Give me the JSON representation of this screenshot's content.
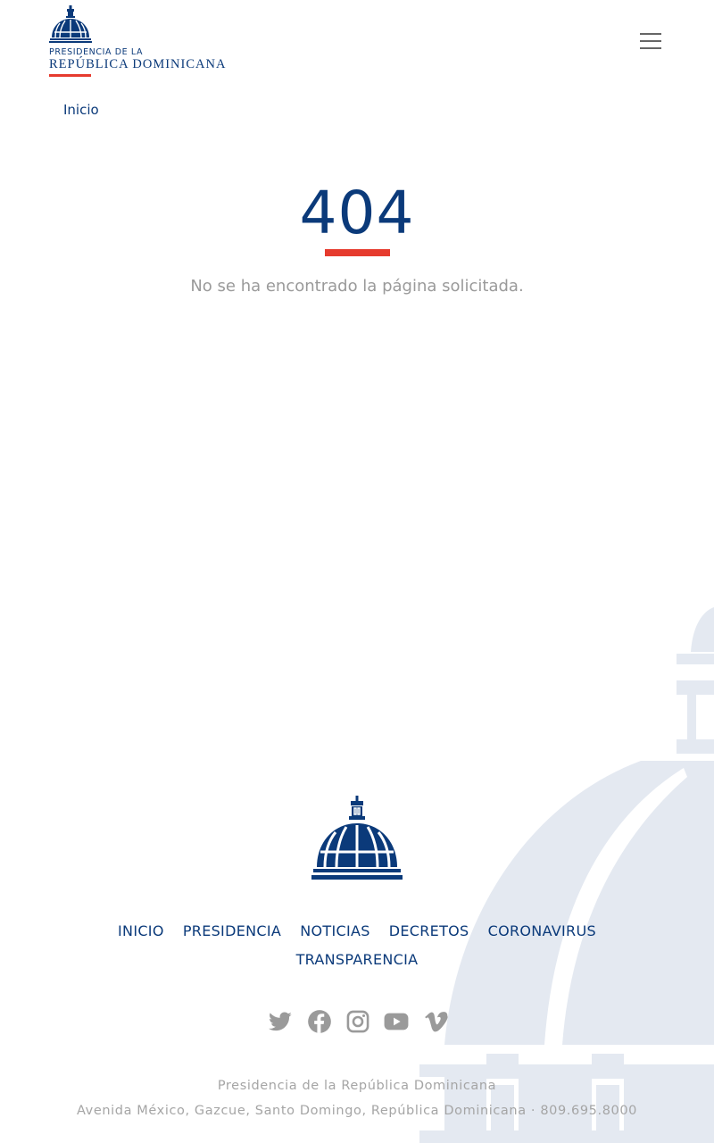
{
  "header": {
    "logo": {
      "line1": "PRESIDENCIA DE LA",
      "line2": "REPÚBLICA DOMINICANA"
    },
    "menu_icon": "hamburger-menu-icon"
  },
  "breadcrumb": {
    "home": "Inicio"
  },
  "error": {
    "code": "404",
    "message": "No se ha encontrado la página solicitada."
  },
  "footer": {
    "nav": [
      "INICIO",
      "PRESIDENCIA",
      "NOTICIAS",
      "DECRETOS",
      "CORONAVIRUS",
      "TRANSPARENCIA"
    ],
    "social": [
      "twitter-icon",
      "facebook-icon",
      "instagram-icon",
      "youtube-icon",
      "vimeo-icon"
    ],
    "org_name": "Presidencia de la República Dominicana",
    "address": "Avenida México, Gazcue, Santo Domingo, República Dominicana · 809.695.8000"
  },
  "colors": {
    "brand_blue": "#0b3a7a",
    "accent_red": "#e63b2e",
    "muted_text": "#9a9a9a",
    "watermark": "#e4e9f1"
  }
}
